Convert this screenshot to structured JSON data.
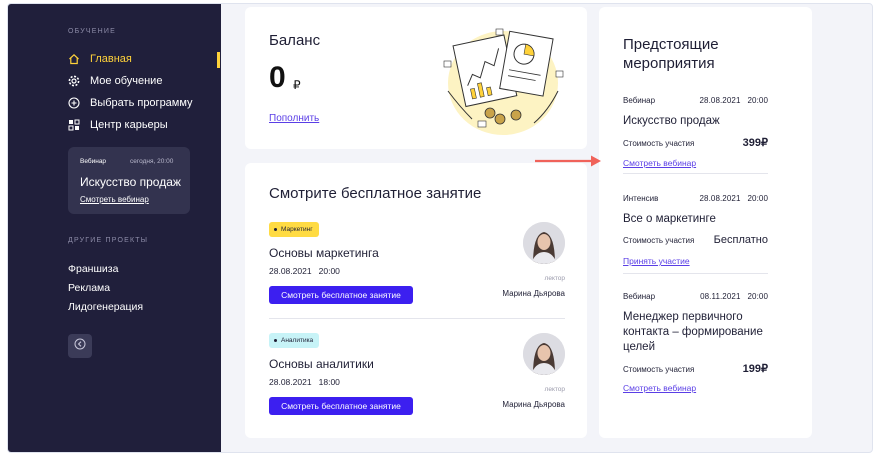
{
  "sidebar": {
    "section_learning": "ОБУЧЕНИЕ",
    "nav": [
      {
        "label": "Главная",
        "icon": "home-icon",
        "active": true
      },
      {
        "label": "Мое обучение",
        "icon": "gear-icon"
      },
      {
        "label": "Выбрать программу",
        "icon": "plus-circle-icon"
      },
      {
        "label": "Центр карьеры",
        "icon": "grid-icon"
      }
    ],
    "webinar_card": {
      "label": "Вебинар",
      "time": "сегодня, 20:00",
      "title": "Искусство продаж",
      "link": "Смотреть вебинар"
    },
    "section_projects": "ДРУГИЕ ПРОЕКТЫ",
    "projects": [
      "Франшиза",
      "Реклама",
      "Лидогенерация"
    ],
    "collapse_icon": "chevron-left-circle-icon"
  },
  "balance": {
    "title": "Баланс",
    "amount": "0",
    "currency": "₽",
    "topup_link": "Пополнить"
  },
  "free_lessons": {
    "title": "Смотрите бесплатное занятие",
    "items": [
      {
        "tag": "Маркетинг",
        "tag_color": "#ffdb43",
        "name": "Основы маркетинга",
        "date": "28.08.2021   20:00",
        "button": "Смотреть бесплатное занятие",
        "lecturer_label": "лектор",
        "lecturer_name": "Марина Дьярова"
      },
      {
        "tag": "Аналитика",
        "tag_color": "#c7f3f7",
        "name": "Основы аналитики",
        "date": "28.08.2021   18:00",
        "button": "Смотреть бесплатное занятие",
        "lecturer_label": "лектор",
        "lecturer_name": "Марина Дьярова"
      }
    ]
  },
  "events": {
    "title": "Предстоящие мероприятия",
    "items": [
      {
        "type": "Вебинар",
        "datetime": "28.08.2021   20:00",
        "name": "Искусство продаж",
        "price_label": "Стоимость участия",
        "price": "399₽",
        "link": "Смотреть вебинар"
      },
      {
        "type": "Интенсив",
        "datetime": "28.08.2021   20:00",
        "name": "Все о маркетинге",
        "price_label": "Стоимость участия",
        "price": "Бесплатно",
        "link": "Принять участие"
      },
      {
        "type": "Вебинар",
        "datetime": "08.11.2021   20:00",
        "name": "Менеджер первичного контакта – формирование целей",
        "price_label": "Стоимость участия",
        "price": "199₽",
        "link": "Смотреть вебинар"
      }
    ]
  },
  "colors": {
    "sidebar_bg": "#201f3b",
    "accent_yellow": "#ffd23a",
    "primary_button": "#3c1ff0",
    "link": "#5a3ee6",
    "arrow": "#f0625a"
  }
}
